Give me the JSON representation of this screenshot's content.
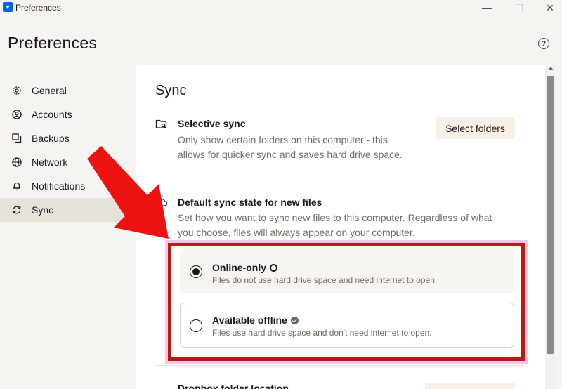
{
  "window": {
    "title": "Preferences",
    "controls": {
      "minimize": "—",
      "maximize": "☐",
      "close": "✕"
    }
  },
  "page": {
    "title": "Preferences",
    "help_icon": "?"
  },
  "sidebar": {
    "items": [
      {
        "label": "General",
        "icon": "gear-icon",
        "active": false
      },
      {
        "label": "Accounts",
        "icon": "account-icon",
        "active": false
      },
      {
        "label": "Backups",
        "icon": "backup-icon",
        "active": false
      },
      {
        "label": "Network",
        "icon": "globe-icon",
        "active": false
      },
      {
        "label": "Notifications",
        "icon": "bell-icon",
        "active": false
      },
      {
        "label": "Sync",
        "icon": "sync-icon",
        "active": true
      }
    ]
  },
  "sync": {
    "title": "Sync",
    "selective": {
      "title": "Selective sync",
      "desc_line1": "Only show certain folders on this computer - this",
      "desc_line2": "allows for quicker sync and saves hard drive space.",
      "button": "Select folders"
    },
    "default_state": {
      "title": "Default sync state for new files",
      "desc_line1": "Set how you want to sync new files to this computer. Regardless of what",
      "desc_line2": "you choose, files will always appear on your computer.",
      "options": [
        {
          "title": "Online-only",
          "desc": "Files do not use hard drive space and need internet to open.",
          "checked": true
        },
        {
          "title": "Available offline",
          "desc": "Files use hard drive space and don't need internet to open.",
          "checked": false
        }
      ]
    },
    "folder_location": {
      "title": "Dropbox folder location"
    }
  },
  "colors": {
    "accent": "#0061fe",
    "highlight": "#b41d14",
    "arrow": "#ee1111",
    "background": "#f6f4f1",
    "active_sidebar": "#e6e1db"
  }
}
